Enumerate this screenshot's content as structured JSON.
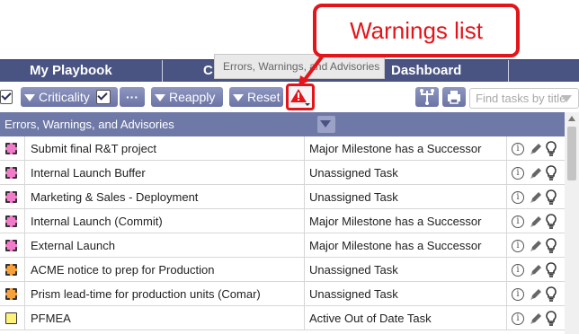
{
  "header": {
    "tabs": [
      "My Playbook",
      "C",
      "Dashboard"
    ]
  },
  "tooltip": "Errors, Warnings, and Advisories",
  "callout": "Warnings list",
  "toolbar": {
    "criticality_label": "Criticality",
    "more_label": "···",
    "reapply_label": "Reapply",
    "reset_label": "Reset",
    "search_placeholder": "Find tasks by title"
  },
  "section": {
    "title": "Errors, Warnings, and Advisories"
  },
  "rows": [
    {
      "task": "Submit final R&T project",
      "issue": "Major Milestone has a Successor",
      "color": "#f07cc9",
      "dashed": true
    },
    {
      "task": "Internal Launch Buffer",
      "issue": "Unassigned Task",
      "color": "#f07cc9",
      "dashed": true
    },
    {
      "task": "Marketing & Sales - Deployment",
      "issue": "Unassigned Task",
      "color": "#f07cc9",
      "dashed": true
    },
    {
      "task": "Internal Launch (Commit)",
      "issue": "Major Milestone has a Successor",
      "color": "#f07cc9",
      "dashed": true
    },
    {
      "task": "External Launch",
      "issue": "Major Milestone has a Successor",
      "color": "#f07cc9",
      "dashed": true
    },
    {
      "task": "ACME notice to prep for Production",
      "issue": "Unassigned Task",
      "color": "#f5a23c",
      "dashed": true
    },
    {
      "task": "Prism lead-time for production units (Comar)",
      "issue": "Unassigned Task",
      "color": "#f5a23c",
      "dashed": true
    },
    {
      "task": "PFMEA",
      "issue": "Active Out of Date Task",
      "color": "#fff27a",
      "dashed": false
    }
  ],
  "icons": {
    "info": "info-icon",
    "edit": "pencil-icon",
    "hint": "lightbulb-icon"
  },
  "colors": {
    "header": "#4a5483",
    "section": "#6f79a7",
    "button": "#7a83b2",
    "callout": "#e3151a",
    "milestone": "#f07cc9",
    "warning": "#f5a23c",
    "ood": "#fff27a"
  }
}
